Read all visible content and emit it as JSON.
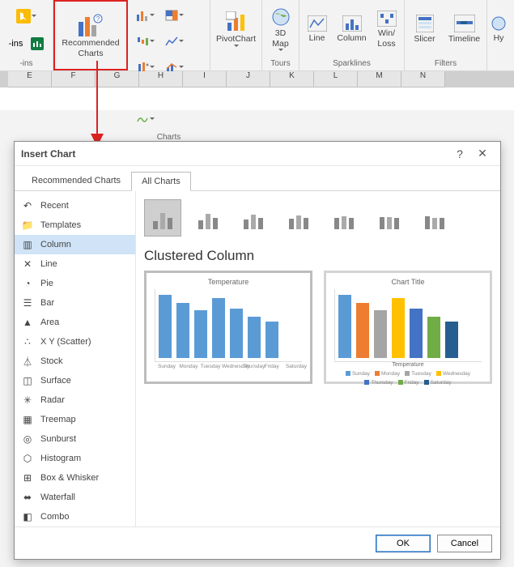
{
  "ribbon": {
    "addins_label": "-ins",
    "recommended": "Recommended\nCharts",
    "charts_group": "Charts",
    "pivotchart": "PivotChart",
    "map3d": "3D\nMap",
    "tours_group": "Tours",
    "spark_line": "Line",
    "spark_col": "Column",
    "spark_wl": "Win/\nLoss",
    "spark_group": "Sparklines",
    "slicer": "Slicer",
    "timeline": "Timeline",
    "filters_group": "Filters",
    "hyper": "Hy"
  },
  "columns": [
    "E",
    "F",
    "G",
    "H",
    "I",
    "J",
    "K",
    "L",
    "M",
    "N"
  ],
  "dialog": {
    "title": "Insert Chart",
    "tabs": {
      "rec": "Recommended Charts",
      "all": "All Charts"
    },
    "active_tab": "all",
    "sidebar": [
      {
        "id": "recent",
        "label": "Recent"
      },
      {
        "id": "templates",
        "label": "Templates"
      },
      {
        "id": "column",
        "label": "Column",
        "selected": true
      },
      {
        "id": "line",
        "label": "Line"
      },
      {
        "id": "pie",
        "label": "Pie"
      },
      {
        "id": "bar",
        "label": "Bar"
      },
      {
        "id": "area",
        "label": "Area"
      },
      {
        "id": "xy",
        "label": "X Y (Scatter)"
      },
      {
        "id": "stock",
        "label": "Stock"
      },
      {
        "id": "surface",
        "label": "Surface"
      },
      {
        "id": "radar",
        "label": "Radar"
      },
      {
        "id": "treemap",
        "label": "Treemap"
      },
      {
        "id": "sunburst",
        "label": "Sunburst"
      },
      {
        "id": "histogram",
        "label": "Histogram"
      },
      {
        "id": "box",
        "label": "Box & Whisker"
      },
      {
        "id": "waterfall",
        "label": "Waterfall"
      },
      {
        "id": "combo",
        "label": "Combo"
      }
    ],
    "subtype_title": "Clustered Column",
    "buttons": {
      "ok": "OK",
      "cancel": "Cancel"
    }
  },
  "chart_data": [
    {
      "type": "bar",
      "title": "Temperature",
      "categories": [
        "Sunday",
        "Monday",
        "Tuesday",
        "Wednesday",
        "Thursday",
        "Friday",
        "Saturday"
      ],
      "values": [
        3.8,
        3.3,
        2.9,
        3.6,
        3.0,
        2.5,
        2.2
      ],
      "ylim": [
        0,
        4.0
      ],
      "xlabel": "",
      "ylabel": "",
      "color": "#5b9bd5"
    },
    {
      "type": "bar",
      "title": "Chart Title",
      "categories": [
        "Sunday",
        "Monday",
        "Tuesday",
        "Wednesday",
        "Thursday",
        "Friday",
        "Saturday"
      ],
      "series": [
        {
          "name": "Temperature",
          "values": [
            3.8,
            3.3,
            2.9,
            3.6,
            3.0,
            2.5,
            2.2
          ]
        }
      ],
      "ylim": [
        0,
        4.0
      ],
      "xlabel": "Temperature",
      "legend": [
        "Sunday",
        "Monday",
        "Tuesday",
        "Wednesday",
        "Thursday",
        "Friday",
        "Saturday"
      ],
      "palette": [
        "#5b9bd5",
        "#ed7d31",
        "#a5a5a5",
        "#ffc000",
        "#4472c4",
        "#70ad47",
        "#255e91"
      ]
    }
  ]
}
